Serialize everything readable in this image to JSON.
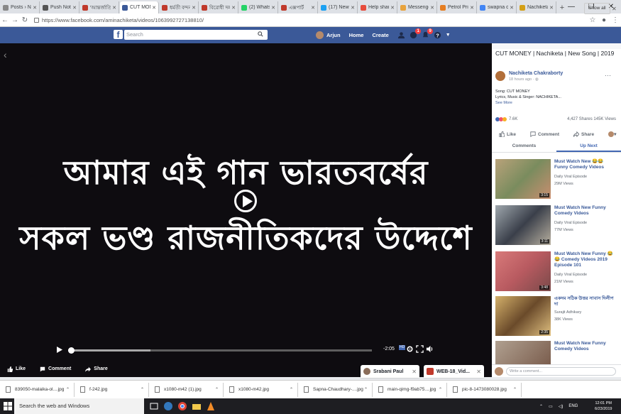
{
  "browser": {
    "tabs": [
      {
        "label": "Posts › Ne",
        "color": "#888"
      },
      {
        "label": "Push Notif",
        "color": "#555"
      },
      {
        "label": "'আন্তর্জাতিক",
        "color": "#c0392b"
      },
      {
        "label": "CUT MON",
        "color": "#3b5998"
      },
      {
        "label": "ধর্মতী বন্দনা",
        "color": "#c0392b"
      },
      {
        "label": "বিরোধী দল",
        "color": "#c0392b"
      },
      {
        "label": "(2) WhatsA",
        "color": "#25d366"
      },
      {
        "label": "এক্সপার্ট",
        "color": "#c0392b"
      },
      {
        "label": "(17) News",
        "color": "#1da1f2"
      },
      {
        "label": "Help shar",
        "color": "#e74c3c"
      },
      {
        "label": "Messenge",
        "color": "#e8a33d"
      },
      {
        "label": "Petrol Pric",
        "color": "#e67e22"
      },
      {
        "label": "swapna ch",
        "color": "#4285f4"
      },
      {
        "label": "Nachiketa",
        "color": "#d4a017"
      }
    ],
    "active_tab_index": 3,
    "url": "https://www.facebook.com/aminachiketa/videos/1063992727138810/"
  },
  "fb_header": {
    "search_placeholder": "Search",
    "user_name": "Arjun",
    "home_label": "Home",
    "create_label": "Create",
    "messages_badge": "1",
    "notifications_badge": "9"
  },
  "video": {
    "line1": "আমার এই গান ভারতবর্ষের",
    "line2": "সকল ভণ্ড রাজনীতিকদের উদ্দেশে",
    "time_remaining": "-2:05",
    "hd_label": "HD",
    "buffered_fraction": 0.27,
    "played_fraction": 0.0
  },
  "video_actions": {
    "like": "Like",
    "comment": "Comment",
    "share": "Share"
  },
  "chats": [
    {
      "name": "Srabani Paul"
    },
    {
      "name": "WEB-18_Vid..."
    }
  ],
  "panel": {
    "title": "CUT MONEY | Nachiketa | New Song | 2019",
    "author": "Nachiketa Chakraborty",
    "time": "18 hours ago · ",
    "desc_line1": "Song: CUT MONEY",
    "desc_line2": "Lyrics, Music & Singer: NACHIKETA...",
    "see_more": "See More",
    "reactions_count": "7.6K",
    "shares_views": "4,427 Shares  145K Views",
    "like_label": "Like",
    "comment_label": "Comment",
    "share_label": "Share",
    "tab_comments": "Comments",
    "tab_upnext": "Up Next",
    "up_next": [
      {
        "title": "Must Watch New 😂😂 Funny Comedy Videos",
        "channel": "Daily Viral Episode",
        "views": "29M Views",
        "duration": "3:15"
      },
      {
        "title": "Must Watch New Funny Comedy Videos",
        "channel": "Daily Viral Episode",
        "views": "77M Views",
        "duration": "3:11"
      },
      {
        "title": "Must Watch New Funny 😂 😂 Comedy Videos 2019 Episode 101",
        "channel": "Daily Viral Episode",
        "views": "21M Views",
        "duration": "3:48"
      },
      {
        "title": "একদম সঠিক উত্তর সাবাস দিলীপ দা",
        "channel": "Surajit Adhikary",
        "views": "38K Views",
        "duration": "2:35"
      },
      {
        "title": "Must Watch New Funny Comedy Videos",
        "channel": "",
        "views": "",
        "duration": ""
      }
    ],
    "comment_placeholder": "Write a comment..."
  },
  "downloads": [
    "839050-malaika-ol....jpg",
    "f-242.jpg",
    "x1080-m42 (1).jpg",
    "x1080-m42.jpg",
    "Sapna-Chaudhary-....jpg",
    "main-qimg-f9ab75....jpg",
    "pic-8-1473080028.jpg"
  ],
  "show_all": "Show all",
  "taskbar": {
    "search_placeholder": "Search the web and Windows",
    "lang": "ENG",
    "time": "12:01 PM",
    "date": "6/23/2019"
  }
}
